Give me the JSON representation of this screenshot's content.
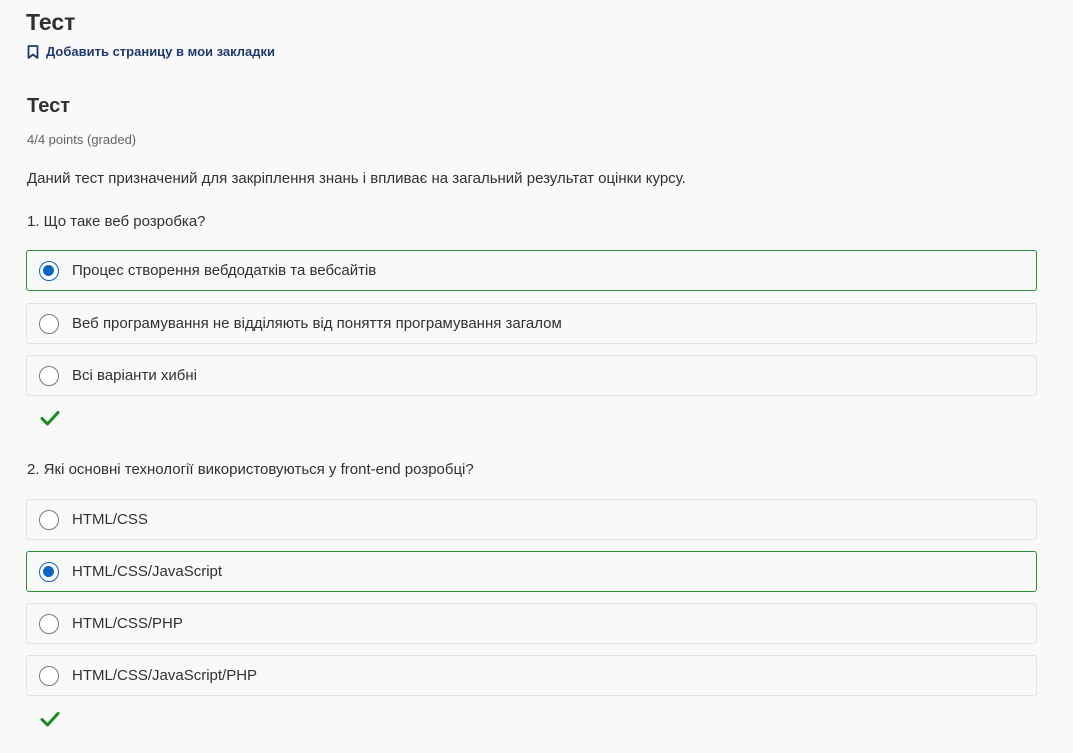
{
  "header": {
    "title": "Тест",
    "bookmark_label": "Добавить страницу в мои закладки",
    "bookmark_icon": "bookmark-icon"
  },
  "quiz": {
    "title": "Тест",
    "points": "4/4 points (graded)",
    "description": "Даний тест призначений для закріплення знань і впливає на загальний результат оцінки курсу.",
    "accent_color": "#0a66c2",
    "correct_color": "#2e8b36",
    "questions": [
      {
        "text": "1. Що таке веб розробка?",
        "options": [
          {
            "label": "Процес створення вебдодатків та вебсайтів",
            "selected": true
          },
          {
            "label": "Веб програмування не відділяють від поняття програмування загалом",
            "selected": false
          },
          {
            "label": "Всі варіанти хибні",
            "selected": false
          }
        ],
        "status_icon": "checkmark-icon",
        "status": "correct"
      },
      {
        "text": "2. Які основні технології використовуються у front-end розробці?",
        "options": [
          {
            "label": "HTML/CSS",
            "selected": false
          },
          {
            "label": "HTML/CSS/JavaScript",
            "selected": true
          },
          {
            "label": "HTML/CSS/PHP",
            "selected": false
          },
          {
            "label": "HTML/CSS/JavaScript/PHP",
            "selected": false
          }
        ],
        "status_icon": "checkmark-icon",
        "status": "correct"
      }
    ]
  }
}
